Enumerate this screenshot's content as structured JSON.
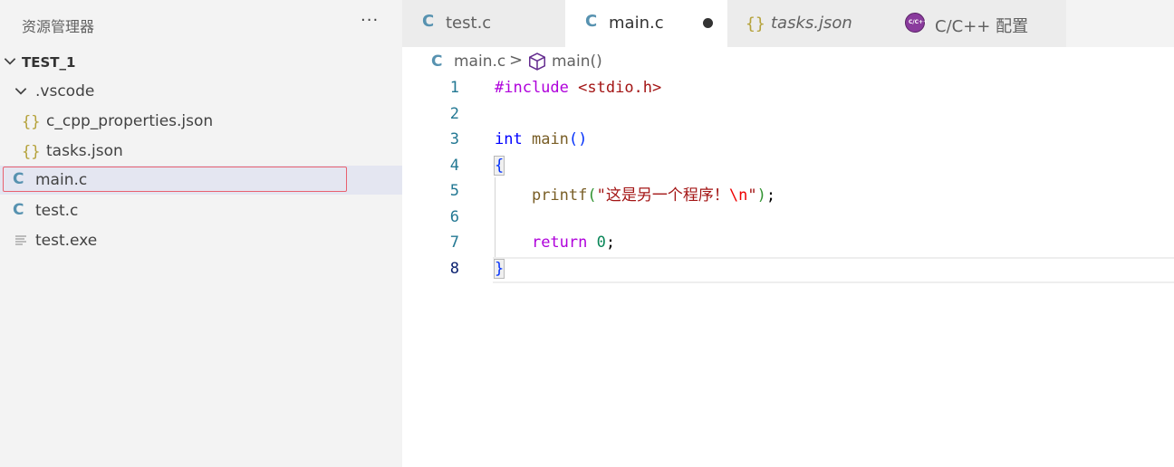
{
  "sidebar": {
    "title": "资源管理器",
    "more": "···",
    "root": "TEST_1",
    "items": [
      {
        "label": ".vscode",
        "icon": "chevron-down-icon"
      },
      {
        "label": "c_cpp_properties.json",
        "icon": "{}"
      },
      {
        "label": "tasks.json",
        "icon": "{}"
      },
      {
        "label": "main.c",
        "icon": "C"
      },
      {
        "label": "test.c",
        "icon": "C"
      },
      {
        "label": "test.exe",
        "icon": "file-lines-icon"
      }
    ]
  },
  "tabs": [
    {
      "label": "test.c",
      "icon": "C"
    },
    {
      "label": "main.c",
      "icon": "C",
      "active": true,
      "dirty": true
    },
    {
      "label": "tasks.json",
      "icon": "{}"
    },
    {
      "label": "C/C++ 配置",
      "icon": "c-cpp-config-icon",
      "icon_text": "C/C++"
    }
  ],
  "breadcrumb": {
    "icon": "C",
    "file": "main.c",
    "separator": ">",
    "symbol": "main()"
  },
  "editor": {
    "line_numbers": [
      "1",
      "2",
      "3",
      "4",
      "5",
      "6",
      "7",
      "8"
    ],
    "lines": {
      "l1": {
        "pre": "#include",
        "inc": "<stdio.h>"
      },
      "l3": {
        "type": "int",
        "fn": "main",
        "open": "(",
        "close": ")"
      },
      "l4": {
        "brace": "{"
      },
      "l5": {
        "fn": "printf",
        "open": "(",
        "str": "\"这是另一个程序！",
        "esc": "\\n",
        "str_end": "\"",
        "close": ")",
        "semi": ";"
      },
      "l7": {
        "kw": "return",
        "num": "0",
        "semi": ";"
      },
      "l8": {
        "brace": "}"
      }
    }
  },
  "colors": {
    "sidebar_bg": "#f3f3f3",
    "selection_bg": "#e4e6f1",
    "focus_border": "#e8616f",
    "c_icon": "#5792b0",
    "json_icon": "#b5a23b",
    "keyword_blue": "#0000ff",
    "preprocessor_purple": "#af00db",
    "string_red": "#a31515",
    "number_green": "#098658",
    "function_brown": "#795e26"
  }
}
